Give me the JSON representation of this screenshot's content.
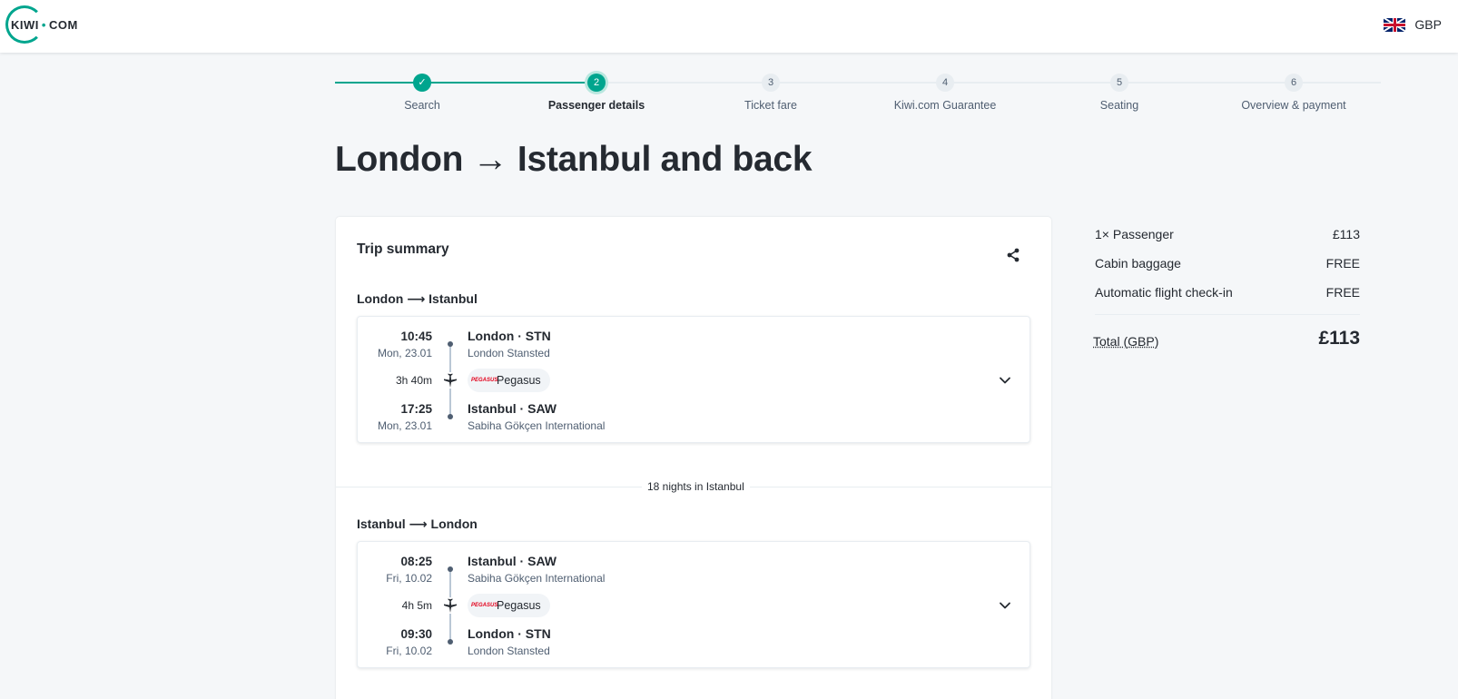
{
  "header": {
    "logo_left": "KIWI",
    "logo_dot": "•",
    "logo_right": "COM",
    "currency": "GBP",
    "currency_flag": "uk-flag-icon"
  },
  "stepper": {
    "steps": [
      {
        "number": "✓",
        "label": "Search",
        "state": "done"
      },
      {
        "number": "2",
        "label": "Passenger details",
        "state": "active"
      },
      {
        "number": "3",
        "label": "Ticket fare",
        "state": "pending"
      },
      {
        "number": "4",
        "label": "Kiwi.com Guarantee",
        "state": "pending"
      },
      {
        "number": "5",
        "label": "Seating",
        "state": "pending"
      },
      {
        "number": "6",
        "label": "Overview & payment",
        "state": "pending"
      }
    ]
  },
  "page_title": "London → Istanbul and back",
  "trip_summary": {
    "title": "Trip summary",
    "nights_label": "18 nights in Istanbul",
    "legs": [
      {
        "title": "London ⟶ Istanbul",
        "departure": {
          "time": "10:45",
          "date": "Mon, 23.01",
          "place": "London · STN",
          "airport": "London Stansted"
        },
        "duration": "3h 40m",
        "carrier": "Pegasus",
        "carrier_logo": "PEGASUS",
        "arrival": {
          "time": "17:25",
          "date": "Mon, 23.01",
          "place": "Istanbul · SAW",
          "airport": "Sabiha Gökçen International"
        }
      },
      {
        "title": "Istanbul ⟶ London",
        "departure": {
          "time": "08:25",
          "date": "Fri, 10.02",
          "place": "Istanbul · SAW",
          "airport": "Sabiha Gökçen International"
        },
        "duration": "4h 5m",
        "carrier": "Pegasus",
        "carrier_logo": "PEGASUS",
        "arrival": {
          "time": "09:30",
          "date": "Fri, 10.02",
          "place": "London · STN",
          "airport": "London Stansted"
        }
      }
    ]
  },
  "price_summary": {
    "rows": [
      {
        "label": "1× Passenger",
        "value": "£113"
      },
      {
        "label": "Cabin baggage",
        "value": "FREE"
      },
      {
        "label": "Automatic flight check-in",
        "value": "FREE"
      }
    ],
    "total_label": "Total (GBP)",
    "total_value": "£113"
  },
  "colors": {
    "accent": "#00a58e",
    "background": "#f5f7f9",
    "text": "#252a31",
    "muted_text": "#4f5e71"
  }
}
